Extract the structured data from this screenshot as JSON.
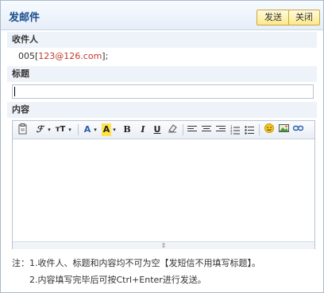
{
  "dialog": {
    "title": "发邮件",
    "send_label": "发送",
    "close_label": "关闭"
  },
  "recipients": {
    "label": "收件人",
    "prefix": "005[",
    "address": "123@126.com",
    "suffix": "];"
  },
  "subject": {
    "label": "标题",
    "value": ""
  },
  "content": {
    "label": "内容",
    "toolbar": {
      "font_label": "ℱ",
      "size_label": "тT",
      "font_color_label": "A",
      "highlight_label": "A",
      "bold_label": "B",
      "italic_label": "I",
      "underline_label": "U",
      "resize_grip": "⇕"
    }
  },
  "notes": {
    "line1": "注：1.收件人、标题和内容均不可为空【发短信不用填写标题】。",
    "line2": "2.内容填写完毕后可按Ctrl+Enter进行发送。"
  },
  "colors": {
    "title": "#1a4d8c",
    "recipient_address": "#c0392b",
    "button_bg": "#fde98a",
    "section_bg": "#eef3f9"
  }
}
